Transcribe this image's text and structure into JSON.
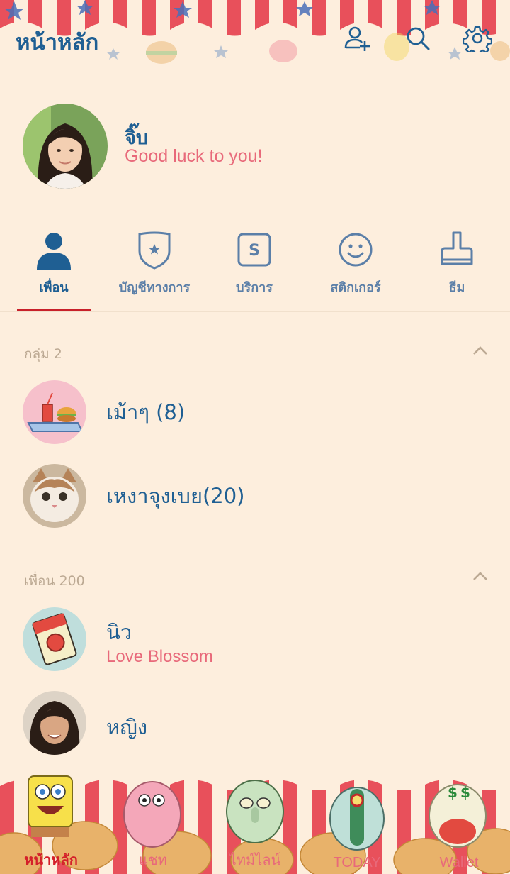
{
  "header": {
    "title": "หน้าหลัก",
    "add_friend_icon": "add-friend-icon",
    "search_icon": "search-icon",
    "settings_icon": "gear-icon"
  },
  "profile": {
    "name": "จิ๊บ",
    "status": "Good luck to you!"
  },
  "tabs": [
    {
      "label": "เพื่อน",
      "icon": "person-icon",
      "active": true
    },
    {
      "label": "บัญชีทางการ",
      "icon": "shield-star-icon",
      "active": false
    },
    {
      "label": "บริการ",
      "icon": "service-s-icon",
      "active": false
    },
    {
      "label": "สติกเกอร์",
      "icon": "smiley-icon",
      "active": false
    },
    {
      "label": "ธีม",
      "icon": "brush-icon",
      "active": false
    }
  ],
  "groups_section": {
    "header": "กลุ่ม 2",
    "items": [
      {
        "name": "เม้าๆ (8)",
        "avatar": "food-tray-avatar"
      },
      {
        "name": "เหงาจุงเบย(20)",
        "avatar": "cat-avatar"
      }
    ]
  },
  "friends_section": {
    "header": "เพื่อน 200",
    "items": [
      {
        "name": "นิว",
        "status": "Love Blossom",
        "avatar": "ketchup-avatar"
      },
      {
        "name": "หญิง",
        "status": "",
        "avatar": "woman-avatar"
      }
    ]
  },
  "bottom_nav": [
    {
      "label": "หน้าหลัก",
      "active": true
    },
    {
      "label": "แชท",
      "active": false
    },
    {
      "label": "ไทม์ไลน์",
      "active": false
    },
    {
      "label": "TODAY",
      "active": false
    },
    {
      "label": "Wallet",
      "active": false
    }
  ],
  "colors": {
    "background": "#fdeedd",
    "primary_blue": "#1f5f93",
    "accent_red": "#c8202a",
    "status_pink": "#e8697a"
  }
}
